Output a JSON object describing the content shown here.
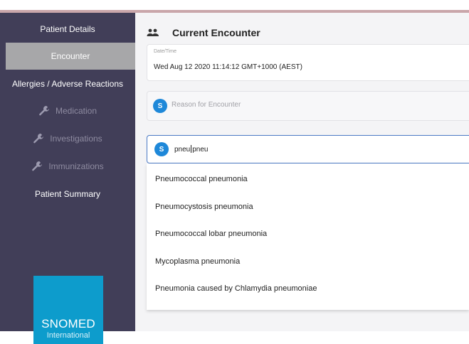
{
  "sidebar": {
    "items": [
      {
        "label": "Patient Details",
        "state": "normal"
      },
      {
        "label": "Encounter",
        "state": "active"
      },
      {
        "label": "Allergies / Adverse Reactions",
        "state": "normal"
      },
      {
        "label": "Medication",
        "state": "disabled",
        "icon": "wrench-icon"
      },
      {
        "label": "Investigations",
        "state": "disabled",
        "icon": "wrench-icon"
      },
      {
        "label": "Immunizations",
        "state": "disabled",
        "icon": "wrench-icon"
      },
      {
        "label": "Patient Summary",
        "state": "normal"
      }
    ],
    "logo": {
      "name": "SNOMED",
      "sub": "International"
    }
  },
  "header": {
    "icon": "people-icon",
    "title": "Current Encounter"
  },
  "datetime": {
    "label": "Date/Time",
    "value": "Wed Aug 12 2020 11:14:12 GMT+1000 (AEST)"
  },
  "reason": {
    "badge": "S",
    "placeholder": "Reason for Encounter"
  },
  "search": {
    "badge": "S",
    "typed_before": "pneu",
    "typed_after": "pneu"
  },
  "suggestions": [
    "Pneumococcal pneumonia",
    "Pneumocystosis pneumonia",
    "Pneumococcal lobar pneumonia",
    "Mycoplasma pneumonia",
    "Pneumonia caused by Chlamydia pneumoniae"
  ],
  "colors": {
    "sidebar": "#413e58",
    "active": "#a7a7a9",
    "accent": "#1e88d9",
    "logo": "#0d9ccc"
  }
}
